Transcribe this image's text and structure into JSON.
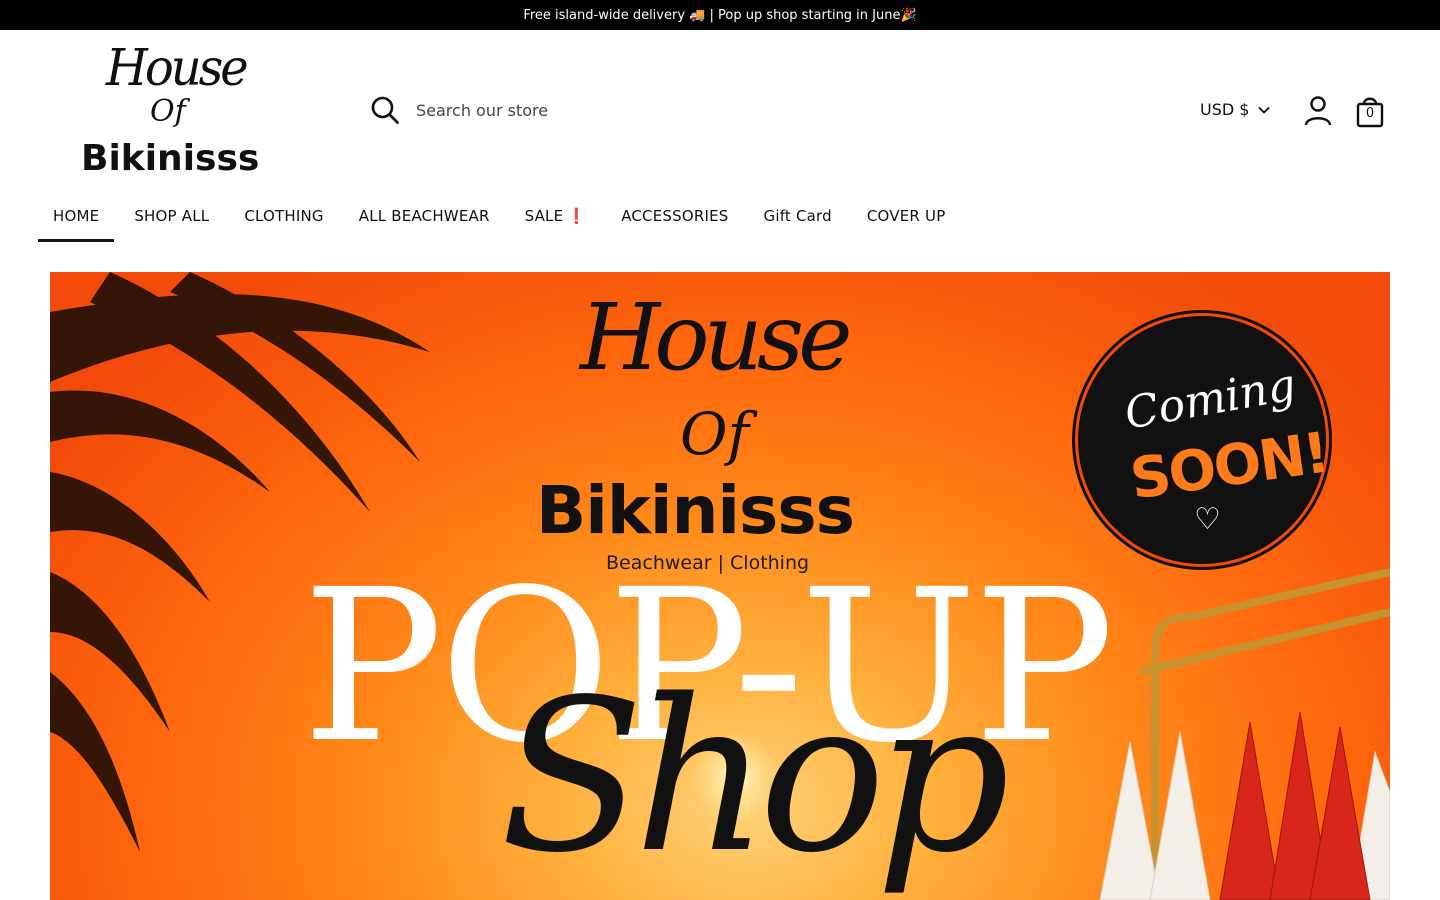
{
  "announcement": {
    "text": "Free island-wide delivery 🚚 | Pop up shop starting in June🎉"
  },
  "logo": {
    "line1": "House",
    "line2": "Of",
    "line3": "Bikinisss"
  },
  "search": {
    "placeholder": "Search our store",
    "icon": "search-icon"
  },
  "header": {
    "currency": "USD $",
    "cart_count": "0",
    "account_icon": "user-icon",
    "cart_icon": "shopping-bag-icon"
  },
  "nav": {
    "items": [
      {
        "label": "HOME",
        "active": true
      },
      {
        "label": "SHOP ALL"
      },
      {
        "label": "CLOTHING"
      },
      {
        "label": "ALL BEACHWEAR"
      },
      {
        "label": "SALE",
        "mark": "❗"
      },
      {
        "label": "ACCESSORIES"
      },
      {
        "label": "Gift Card"
      },
      {
        "label": "COVER UP"
      }
    ]
  },
  "hero": {
    "brand_line1": "House",
    "brand_line2": "Of",
    "brand_line3": "Bikinisss",
    "subtitle": "Beachwear | Clothing",
    "headline": "POP-UP",
    "script": "Shop",
    "heart": "♡",
    "badge": {
      "line1": "Coming",
      "line2": "SOON!",
      "heart": "♡"
    },
    "colors": {
      "top": "#f24a0a",
      "bottom": "#ffb23f",
      "accent": "#ff7a1a"
    }
  }
}
